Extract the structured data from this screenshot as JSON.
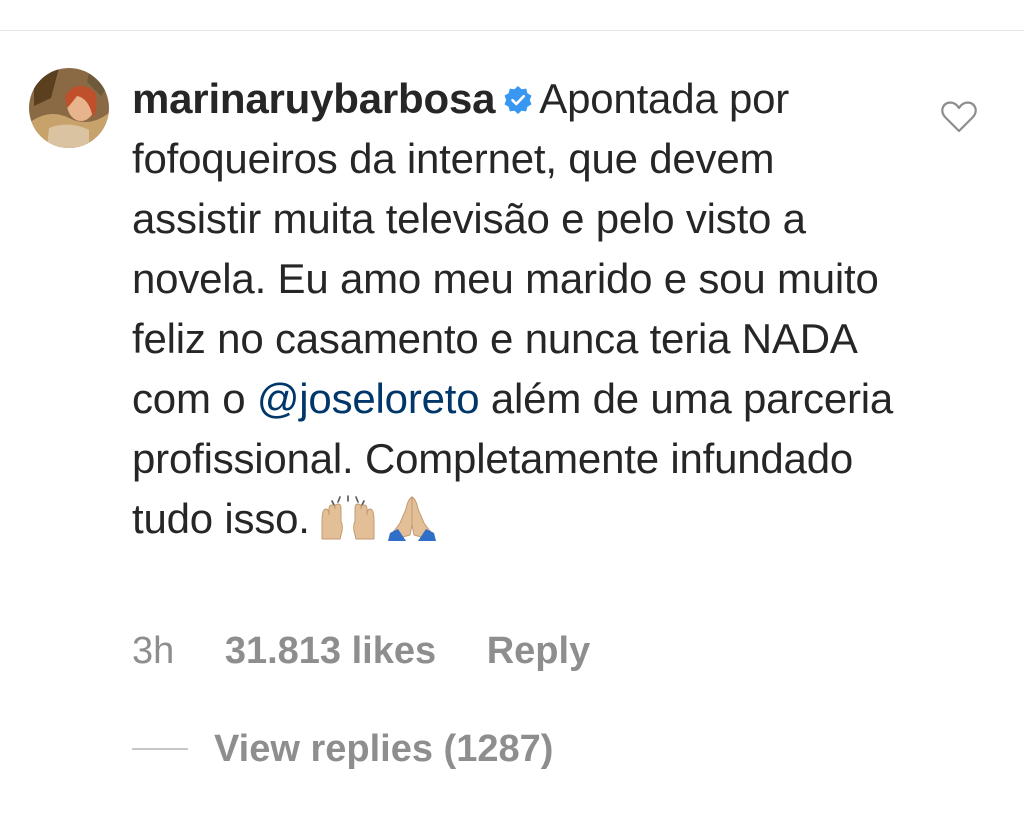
{
  "comment": {
    "username": "marinaruybarbosa",
    "text_before_mention": "Apontada por fofoqueiros da internet, que devem assistir muita televisão e pelo visto a novela. Eu amo meu marido e sou muito feliz no casamento e nunca teria NADA com o",
    "mention": "@joseloreto",
    "text_after_mention": "além de uma parceria profissional. Completamente infundado tudo isso.",
    "emojis": [
      "raising-hands",
      "folded-hands"
    ],
    "timestamp": "3h",
    "likes": "31.813 likes",
    "reply_label": "Reply",
    "view_replies": "View replies (1287)"
  },
  "icons": {
    "verified": "verified-badge-icon",
    "like": "heart-outline-icon"
  },
  "colors": {
    "text": "#262626",
    "secondary": "#8e8e8e",
    "mention": "#00376b",
    "verified": "#3897f0"
  }
}
